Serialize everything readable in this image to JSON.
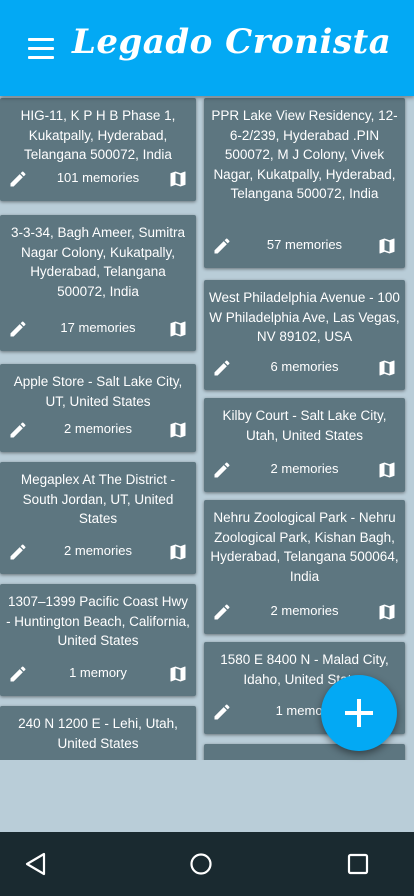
{
  "app": {
    "title": "Legado Cronista"
  },
  "icons": {
    "menu": "hamburger-menu-icon",
    "edit": "pencil-icon",
    "map": "map-icon",
    "add": "plus-icon",
    "back": "back-triangle-icon",
    "home": "home-circle-icon",
    "recents": "recents-square-icon"
  },
  "colors": {
    "primary": "#03a9f4",
    "card": "#5d7680",
    "background": "#b9cdd8",
    "navbar": "#1a2a30"
  },
  "left_cards": [
    {
      "address": "HIG-11, K P H B Phase 1, Kukatpally, Hyderabad, Telangana 500072, India",
      "count": "101 memories"
    },
    {
      "address": "3-3-34, Bagh Ameer, Sumitra Nagar Colony, Kukatpally, Hyderabad, Telangana 500072, India",
      "count": "17 memories"
    },
    {
      "address": "Apple Store - Salt Lake City, UT, United States",
      "count": "2 memories"
    },
    {
      "address": "Megaplex At The District - South Jordan, UT, United States",
      "count": "2 memories"
    },
    {
      "address": "1307–1399 Pacific Coast Hwy - Huntington Beach, California, United States",
      "count": "1 memory"
    },
    {
      "address": "240 N 1200 E - Lehi, Utah, United States",
      "count": ""
    }
  ],
  "right_cards": [
    {
      "address": "PPR Lake View Residency, 12-6-2/239, Hyderabad .PIN 500072, M J Colony, Vivek Nagar, Kukatpally, Hyderabad, Telangana 500072, India",
      "count": "57 memories"
    },
    {
      "address": "West Philadelphia Avenue - 100 W Philadelphia Ave, Las Vegas, NV 89102, USA",
      "count": "6 memories"
    },
    {
      "address": "Kilby Court - Salt Lake City, Utah, United States",
      "count": "2 memories"
    },
    {
      "address": "Nehru Zoological Park - Nehru Zoological Park, Kishan Bagh, Hyderabad, Telangana 500064, India",
      "count": "2 memories"
    },
    {
      "address": "1580 E 8400 N - Malad City, Idaho, United States",
      "count": "1 memory"
    },
    {
      "address": "",
      "count": ""
    }
  ]
}
